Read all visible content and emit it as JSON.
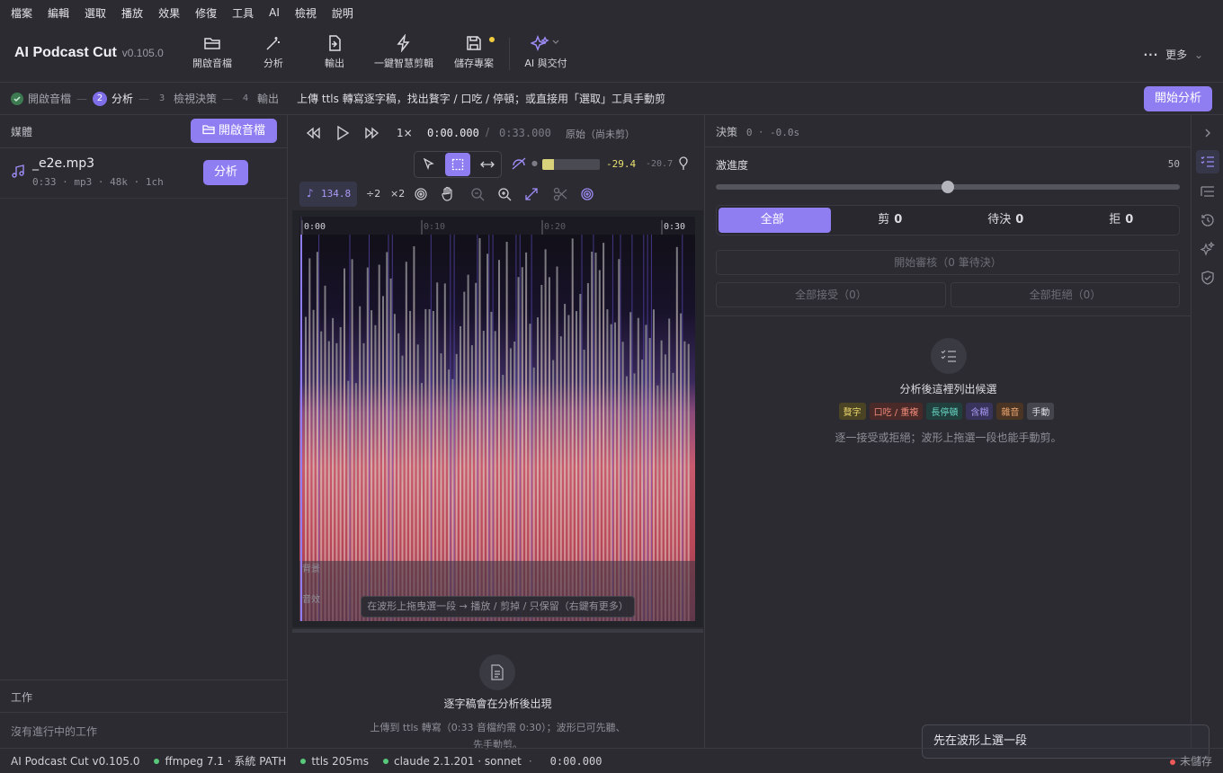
{
  "menu": [
    "檔案",
    "編輯",
    "選取",
    "播放",
    "效果",
    "修復",
    "工具",
    "AI",
    "檢視",
    "說明"
  ],
  "app": {
    "name": "AI Podcast Cut",
    "version": "v0.105.0"
  },
  "toolbar": {
    "open": "開啟音檔",
    "analyze": "分析",
    "export": "輸出",
    "smart_cut": "一鍵智慧剪輯",
    "save": "儲存專案",
    "ai": "AI 與交付",
    "more": "更多"
  },
  "steps": {
    "s1": "開啟音檔",
    "s2_num": "2",
    "s2": "分析",
    "s3_num": "3",
    "s3": "檢視決策",
    "s4_num": "4",
    "s4": "輸出",
    "hint": "上傳 ttls 轉寫逐字稿，找出贅字 / 口吃 / 停頓；或直接用「選取」工具手動剪",
    "start": "開始分析"
  },
  "media": {
    "title": "媒體",
    "open_btn": "開啟音檔",
    "file": {
      "name": "_e2e.mp3",
      "meta": "0:33 · mp3 · 48k · 1ch",
      "action": "分析"
    },
    "jobs_title": "工作",
    "jobs_empty": "沒有進行中的工作"
  },
  "transport": {
    "speed": "1×",
    "current": "0:00.000",
    "slash": "/",
    "total": "0:33.000",
    "mode": "原始（尚未剪）",
    "gain_db": "-29.4",
    "peak_db": "-20.7",
    "gain_level": 0.2
  },
  "tools": {
    "bpm": "134.8",
    "div2": "÷2",
    "mul2": "×2"
  },
  "waveform": {
    "ticks": [
      "0:00",
      "0:10",
      "0:20",
      "0:30"
    ],
    "lane1": "背景",
    "lane2": "音效",
    "hint": "在波形上拖曳選一段 → 播放 / 剪掉 / 只保留（右鍵有更多）"
  },
  "transcript": {
    "title": "逐字稿會在分析後出現",
    "desc1": "上傳到 ttls 轉寫（0:33 音檔約需 0:30）；波形已可先聽、",
    "desc2": "先手動剪。"
  },
  "decisions": {
    "header": "決策",
    "count": "0",
    "dot": "·",
    "saved": "-0.0s",
    "aggr_label": "激進度",
    "aggr_value": "50",
    "aggr_level": 0.5,
    "tabs": [
      {
        "label": "全部",
        "count": ""
      },
      {
        "label": "剪",
        "count": "0"
      },
      {
        "label": "待決",
        "count": "0"
      },
      {
        "label": "拒",
        "count": "0"
      }
    ],
    "review": "開始審核（0 筆待決）",
    "accept_all": "全部接受（0）",
    "reject_all": "全部拒絕（0）",
    "empty_title": "分析後這裡列出候選",
    "tags": [
      {
        "label": "贅字",
        "color": "#e8d26a",
        "bg": "#4a4424"
      },
      {
        "label": "口吃 / 重複",
        "color": "#f08a7a",
        "bg": "#4a2a28"
      },
      {
        "label": "長停頓",
        "color": "#6ad8c8",
        "bg": "#213f3c"
      },
      {
        "label": "含糊",
        "color": "#a99af4",
        "bg": "#38335a"
      },
      {
        "label": "雜音",
        "color": "#f0a870",
        "bg": "#4a3424"
      },
      {
        "label": "手動",
        "color": "#dcdce2",
        "bg": "#45454d"
      }
    ],
    "empty_desc": "逐一接受或拒絕；波形上拖選一段也能手動剪。"
  },
  "toast": "先在波形上選一段",
  "status": {
    "app": "AI Podcast Cut v0.105.0",
    "ffmpeg": "ffmpeg 7.1 · 系統 PATH",
    "ttls": "ttls 205ms",
    "claude": "claude 2.1.201 · sonnet",
    "arrow": "·",
    "time": "0:00.000",
    "unsaved": "未儲存"
  }
}
